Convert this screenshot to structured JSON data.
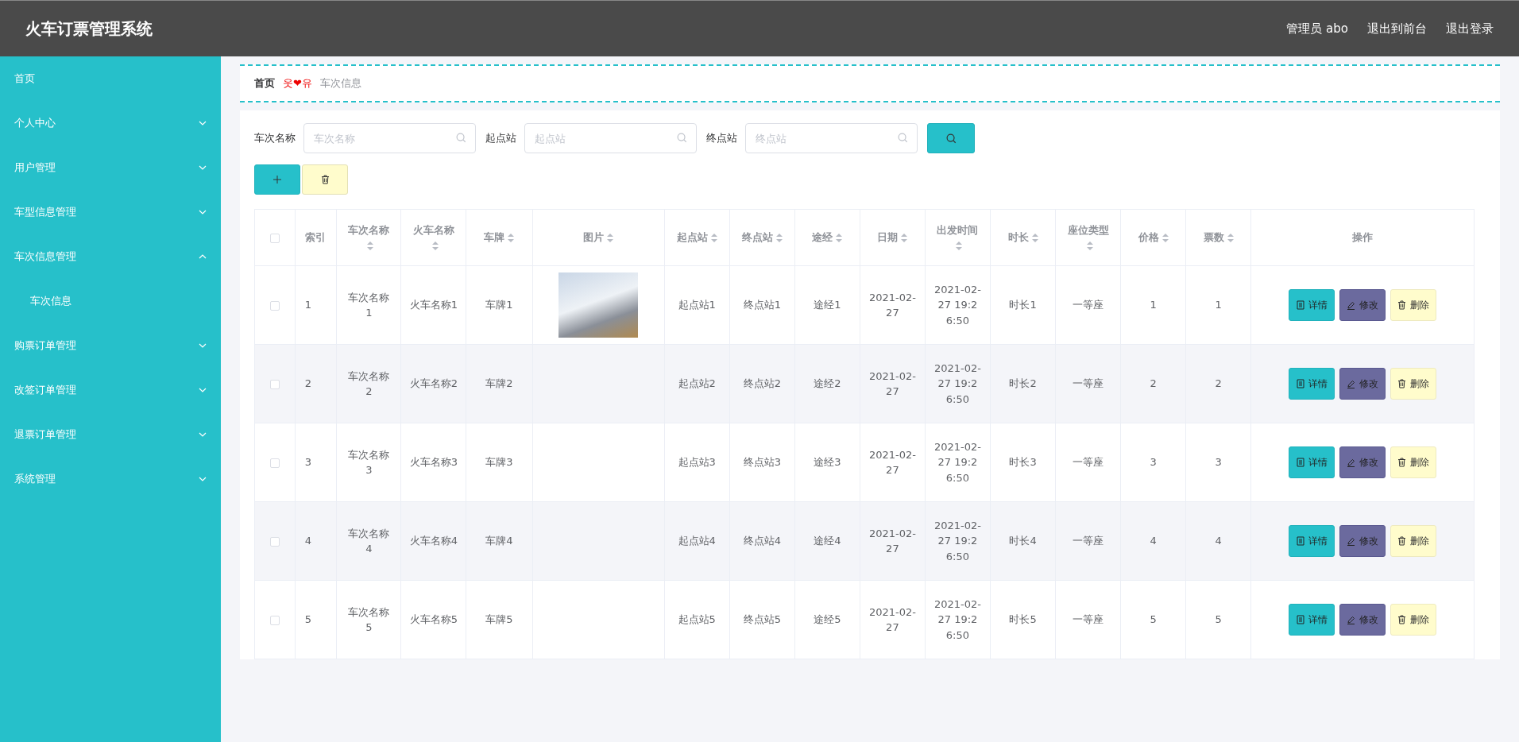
{
  "header": {
    "title": "火车订票管理系统",
    "links": [
      "管理员 abo",
      "退出到前台",
      "退出登录"
    ]
  },
  "sidebar": {
    "items": [
      {
        "label": "首页",
        "has_arrow": false
      },
      {
        "label": "个人中心",
        "has_arrow": true,
        "expanded": false
      },
      {
        "label": "用户管理",
        "has_arrow": true,
        "expanded": false
      },
      {
        "label": "车型信息管理",
        "has_arrow": true,
        "expanded": false
      },
      {
        "label": "车次信息管理",
        "has_arrow": true,
        "expanded": true,
        "children": [
          {
            "label": "车次信息"
          }
        ]
      },
      {
        "label": "购票订单管理",
        "has_arrow": true,
        "expanded": false
      },
      {
        "label": "改签订单管理",
        "has_arrow": true,
        "expanded": false
      },
      {
        "label": "退票订单管理",
        "has_arrow": true,
        "expanded": false
      },
      {
        "label": "系统管理",
        "has_arrow": true,
        "expanded": false
      }
    ]
  },
  "breadcrumb": {
    "home": "首页",
    "separator": "웃❤유",
    "current": "车次信息"
  },
  "search": {
    "fields": [
      {
        "label": "车次名称",
        "placeholder": "车次名称"
      },
      {
        "label": "起点站",
        "placeholder": "起点站"
      },
      {
        "label": "终点站",
        "placeholder": "终点站"
      }
    ]
  },
  "table": {
    "all_selected": false,
    "columns": [
      {
        "label": "索引",
        "sortable": false
      },
      {
        "label": "车次名称",
        "sortable": true
      },
      {
        "label": "火车名称",
        "sortable": true
      },
      {
        "label": "车牌",
        "sortable": true
      },
      {
        "label": "图片",
        "sortable": true
      },
      {
        "label": "起点站",
        "sortable": true
      },
      {
        "label": "终点站",
        "sortable": true
      },
      {
        "label": "途经",
        "sortable": true
      },
      {
        "label": "日期",
        "sortable": true
      },
      {
        "label": "出发时间",
        "sortable": true
      },
      {
        "label": "时长",
        "sortable": true
      },
      {
        "label": "座位类型",
        "sortable": true
      },
      {
        "label": "价格",
        "sortable": true
      },
      {
        "label": "票数",
        "sortable": true
      },
      {
        "label": "操作",
        "sortable": false
      }
    ],
    "rows": [
      {
        "selected": false,
        "photo": true,
        "cells": [
          "1",
          "车次名称1",
          "火车名称1",
          "车牌1",
          "",
          "起点站1",
          "终点站1",
          "途经1",
          "2021-02-27",
          "2021-02-27 19:26:50",
          "时长1",
          "一等座",
          "1",
          "1"
        ],
        "actions": [
          {
            "kind": "detail",
            "label": "详情"
          },
          {
            "kind": "edit",
            "label": "修改"
          },
          {
            "kind": "delete",
            "label": "删除"
          }
        ]
      },
      {
        "selected": false,
        "photo": false,
        "cells": [
          "2",
          "车次名称2",
          "火车名称2",
          "车牌2",
          "",
          "起点站2",
          "终点站2",
          "途经2",
          "2021-02-27",
          "2021-02-27 19:26:50",
          "时长2",
          "一等座",
          "2",
          "2"
        ],
        "actions": [
          {
            "kind": "detail",
            "label": "详情"
          },
          {
            "kind": "edit",
            "label": "修改"
          },
          {
            "kind": "delete",
            "label": "删除"
          }
        ]
      },
      {
        "selected": false,
        "photo": false,
        "cells": [
          "3",
          "车次名称3",
          "火车名称3",
          "车牌3",
          "",
          "起点站3",
          "终点站3",
          "途经3",
          "2021-02-27",
          "2021-02-27 19:26:50",
          "时长3",
          "一等座",
          "3",
          "3"
        ],
        "actions": [
          {
            "kind": "detail",
            "label": "详情"
          },
          {
            "kind": "edit",
            "label": "修改"
          },
          {
            "kind": "delete",
            "label": "删除"
          }
        ]
      },
      {
        "selected": false,
        "photo": false,
        "cells": [
          "4",
          "车次名称4",
          "火车名称4",
          "车牌4",
          "",
          "起点站4",
          "终点站4",
          "途经4",
          "2021-02-27",
          "2021-02-27 19:26:50",
          "时长4",
          "一等座",
          "4",
          "4"
        ],
        "actions": [
          {
            "kind": "detail",
            "label": "详情"
          },
          {
            "kind": "edit",
            "label": "修改"
          },
          {
            "kind": "delete",
            "label": "删除"
          }
        ]
      },
      {
        "selected": false,
        "photo": false,
        "cells": [
          "5",
          "车次名称5",
          "火车名称5",
          "车牌5",
          "",
          "起点站5",
          "终点站5",
          "途经5",
          "2021-02-27",
          "2021-02-27 19:26:50",
          "时长5",
          "一等座",
          "5",
          "5"
        ],
        "actions": [
          {
            "kind": "detail",
            "label": "详情"
          },
          {
            "kind": "edit",
            "label": "修改"
          },
          {
            "kind": "delete",
            "label": "删除"
          }
        ]
      }
    ]
  }
}
